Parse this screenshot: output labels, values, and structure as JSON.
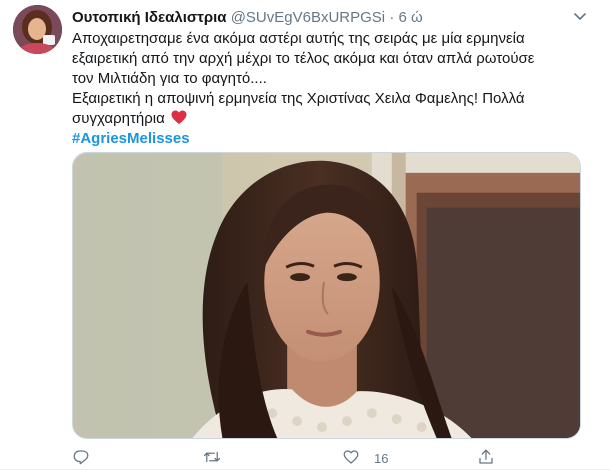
{
  "tweet": {
    "display_name": "Ουτοπική Ιδεαλιστρια",
    "handle": "@SUvEgV6BxURPGSi",
    "separator": "·",
    "time": "6 ώ",
    "lines": [
      "Αποχαιρετησαμε ένα ακόμα αστέρι αυτής της σειράς με μία ερμηνεία",
      "εξαιρετική από την αρχή μέχρι το τέλος ακόμα και όταν απλά ρωτούσε",
      "τον Μιλτιάδη για το φαγητό....",
      "Εξαιρετική η αποψινή ερμηνεία της Χριστίνας Χειλα Φαμελης! Πολλά",
      "συγχαρητήρια"
    ],
    "hashtag": "#AgriesMelisses",
    "emoji_icon": "red-heart-emoji",
    "accent_color": "#1b95e0",
    "like_color": "#e0245e"
  },
  "actions": {
    "reply_icon": "reply-icon",
    "retweet_icon": "retweet-icon",
    "like_icon": "like-icon",
    "like_count": "16",
    "share_icon": "share-icon"
  }
}
